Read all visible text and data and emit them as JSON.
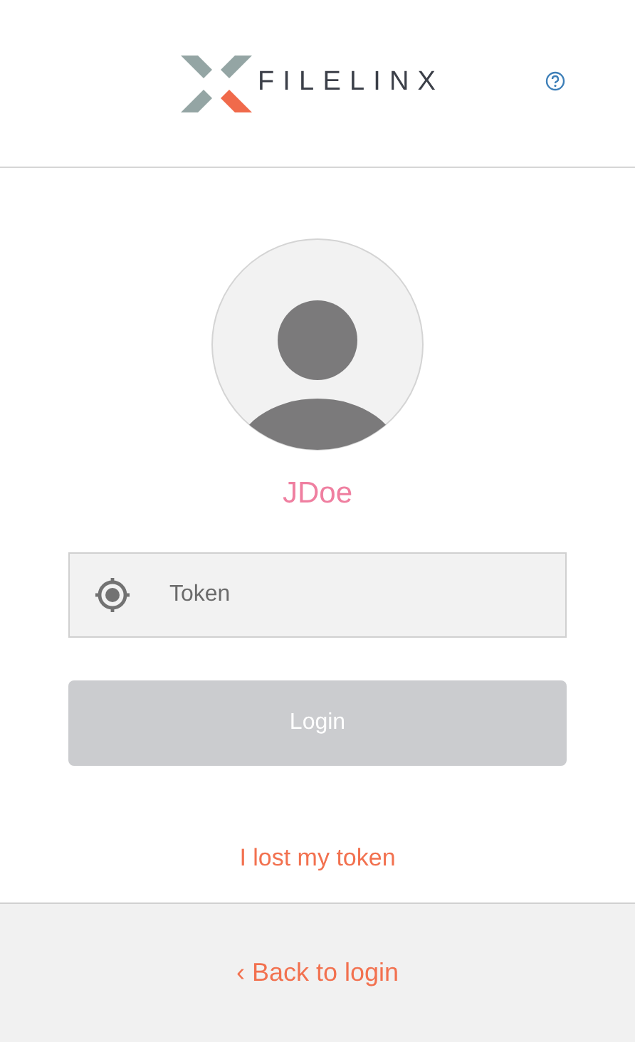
{
  "header": {
    "brand": "FILELINX"
  },
  "user": {
    "name": "JDoe"
  },
  "token_field": {
    "placeholder": "Token"
  },
  "login_button": {
    "label": "Login",
    "disabled": true
  },
  "lost_link": "I lost my token",
  "footer": {
    "back_link": "‹ Back to login"
  }
}
